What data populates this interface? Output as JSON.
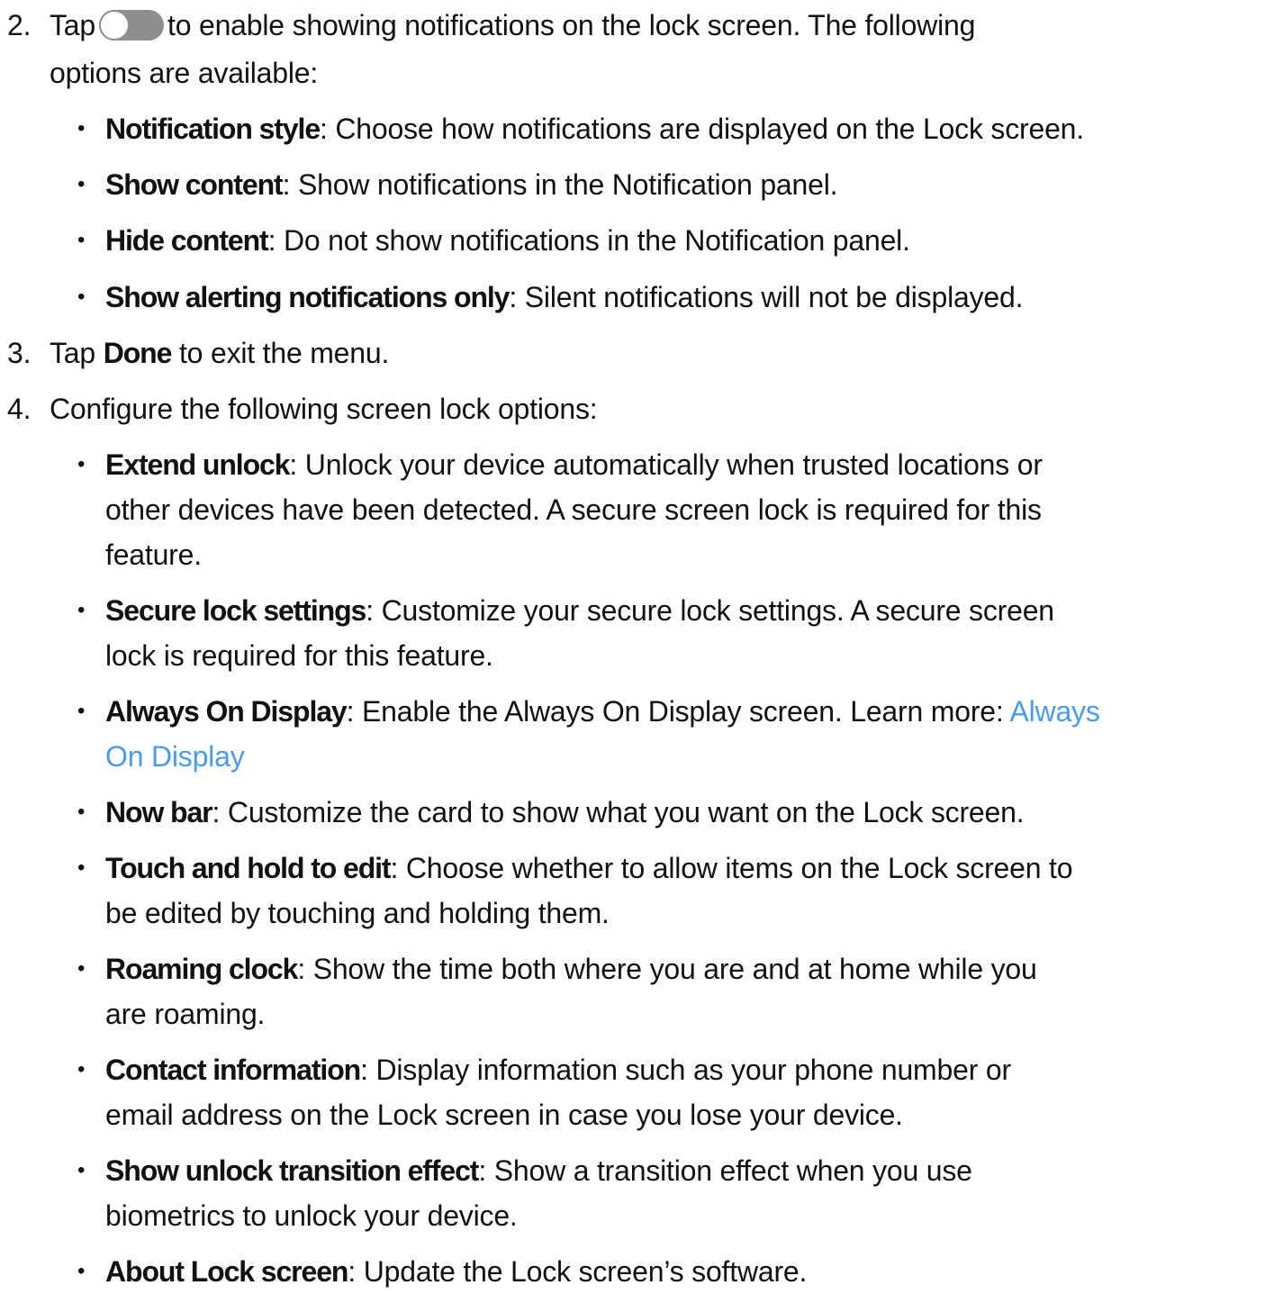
{
  "step2": {
    "number": "2.",
    "pre": "Tap",
    "post": "to enable showing notifications on the lock screen. The following",
    "line2": "options are available:",
    "toggle_icon": "toggle-icon",
    "bullets": [
      {
        "term": "Notification style",
        "desc": ": Choose how notifications are displayed on the Lock screen."
      },
      {
        "term": "Show content",
        "desc": ": Show notifications in the Notification panel."
      },
      {
        "term": "Hide content",
        "desc": ": Do not show notifications in the Notification panel."
      },
      {
        "term": "Show alerting notifications only",
        "desc": ": Silent notifications will not be displayed."
      }
    ]
  },
  "step3": {
    "number": "3.",
    "pre": "Tap ",
    "term": "Done",
    "post": " to exit the menu."
  },
  "step4": {
    "number": "4.",
    "text": "Configure the following screen lock options:",
    "bullets": [
      {
        "term": "Extend unlock",
        "lines": [
          ": Unlock your device automatically when trusted locations or",
          "other devices have been detected. A secure screen lock is required for this",
          "feature."
        ]
      },
      {
        "term": "Secure lock settings",
        "lines": [
          ": Customize your secure lock settings. A secure screen",
          "lock is required for this feature."
        ]
      },
      {
        "term": "Always On Display",
        "lines": [
          ": Enable the Always On Display screen. Learn more: "
        ],
        "link_part1": "Always",
        "link_part2": "On Display"
      },
      {
        "term": "Now bar",
        "lines": [
          ": Customize the card to show what you want on the Lock screen."
        ]
      },
      {
        "term": "Touch and hold to edit",
        "lines": [
          ": Choose whether to allow items on the Lock screen to",
          "be edited by touching and holding them."
        ]
      },
      {
        "term": "Roaming clock",
        "lines": [
          ": Show the time both where you are and at home while you",
          "are roaming."
        ]
      },
      {
        "term": "Contact information",
        "lines": [
          ": Display information such as your phone number or",
          "email address on the Lock screen in case you lose your device."
        ]
      },
      {
        "term": "Show unlock transition effect",
        "lines": [
          ": Show a transition effect when you use",
          "biometrics to unlock your device."
        ]
      },
      {
        "term": "About Lock screen",
        "lines": [
          ": Update the Lock screen’s software."
        ]
      }
    ]
  },
  "colors": {
    "text": "#111111",
    "link": "#4a9be8",
    "toggle": "#8e8e8e"
  }
}
